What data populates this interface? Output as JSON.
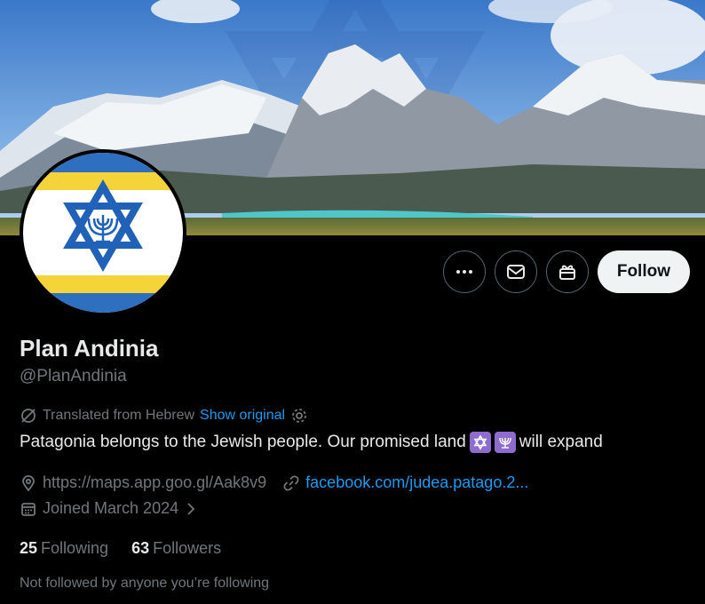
{
  "profile": {
    "name": "Plan Andinia",
    "handle": "@PlanAndinia",
    "translated_label": "Translated from Hebrew",
    "show_original": "Show original",
    "bio": "Patagonia belongs to the Jewish people. Our promised land",
    "bio_suffix": "will expand",
    "location": "https://maps.app.goo.gl/Aak8v9",
    "website": "facebook.com/judea.patago.2...",
    "joined": "Joined March 2024",
    "following_count": "25",
    "following_label": "Following",
    "followers_count": "63",
    "followers_label": "Followers",
    "followed_note": "Not followed by anyone you’re following"
  },
  "actions": {
    "follow_label": "Follow",
    "more_icon": "more-icon",
    "message_icon": "envelope-icon",
    "gift_icon": "gift-icon"
  },
  "colors": {
    "link": "#1d9bf0",
    "muted": "#71767b",
    "text": "#e7e9ea",
    "follow_bg": "#eff3f4"
  }
}
